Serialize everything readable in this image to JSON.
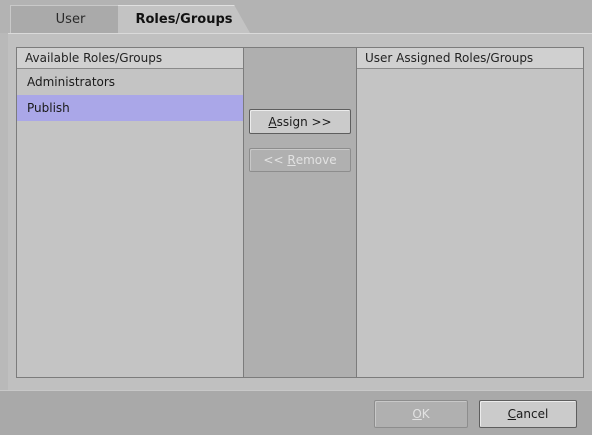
{
  "tabs": {
    "user": "User",
    "roles_groups": "Roles/Groups"
  },
  "available": {
    "header": "Available Roles/Groups",
    "items": [
      "Administrators",
      "Publish"
    ]
  },
  "assigned": {
    "header": "User Assigned Roles/Groups",
    "items": []
  },
  "buttons": {
    "assign": {
      "mnemonic": "A",
      "rest": "ssign >>"
    },
    "remove": {
      "prefix": "<< ",
      "mnemonic": "R",
      "rest": "emove"
    },
    "ok": {
      "mnemonic": "O",
      "rest": "K"
    },
    "cancel": {
      "mnemonic": "C",
      "rest": "ancel"
    }
  }
}
